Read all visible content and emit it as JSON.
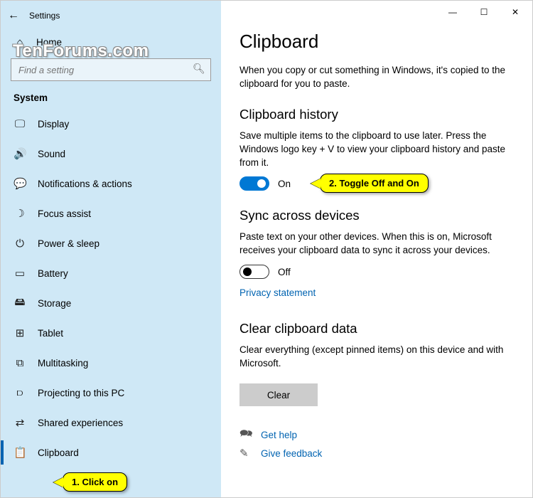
{
  "watermark": "TenForums.com",
  "window": {
    "back": "←",
    "title": "Settings",
    "min": "—",
    "max": "☐",
    "close": "✕"
  },
  "sidebar": {
    "home_icon": "⌂",
    "home_label": "Home",
    "search_placeholder": "Find a setting",
    "search_icon": "🔍︎",
    "section_label": "System",
    "items": [
      {
        "icon": "🖵",
        "label": "Display"
      },
      {
        "icon": "🔊",
        "label": "Sound"
      },
      {
        "icon": "💬",
        "label": "Notifications & actions"
      },
      {
        "icon": "☽",
        "label": "Focus assist"
      },
      {
        "icon": "⏻",
        "label": "Power & sleep"
      },
      {
        "icon": "▭",
        "label": "Battery"
      },
      {
        "icon": "🖴",
        "label": "Storage"
      },
      {
        "icon": "⊞",
        "label": "Tablet"
      },
      {
        "icon": "⧉",
        "label": "Multitasking"
      },
      {
        "icon": "⫐",
        "label": "Projecting to this PC"
      },
      {
        "icon": "⇄",
        "label": "Shared experiences"
      },
      {
        "icon": "📋",
        "label": "Clipboard"
      }
    ],
    "selected_index": 11
  },
  "main": {
    "title": "Clipboard",
    "intro": "When you copy or cut something in Windows, it's copied to the clipboard for you to paste.",
    "history": {
      "heading": "Clipboard history",
      "desc": "Save multiple items to the clipboard to use later. Press the Windows logo key + V to view your clipboard history and paste from it.",
      "toggle_state": "On"
    },
    "sync": {
      "heading": "Sync across devices",
      "desc": "Paste text on your other devices. When this is on, Microsoft receives your clipboard data to sync it across your devices.",
      "toggle_state": "Off",
      "privacy_link": "Privacy statement"
    },
    "clear": {
      "heading": "Clear clipboard data",
      "desc": "Clear everything (except pinned items) on this device and with Microsoft.",
      "button": "Clear"
    },
    "help": {
      "get_help_icon": "🗪",
      "get_help": "Get help",
      "feedback_icon": "✎",
      "feedback": "Give feedback"
    }
  },
  "callouts": {
    "c1": "1. Click on",
    "c2": "2. Toggle Off and On"
  }
}
